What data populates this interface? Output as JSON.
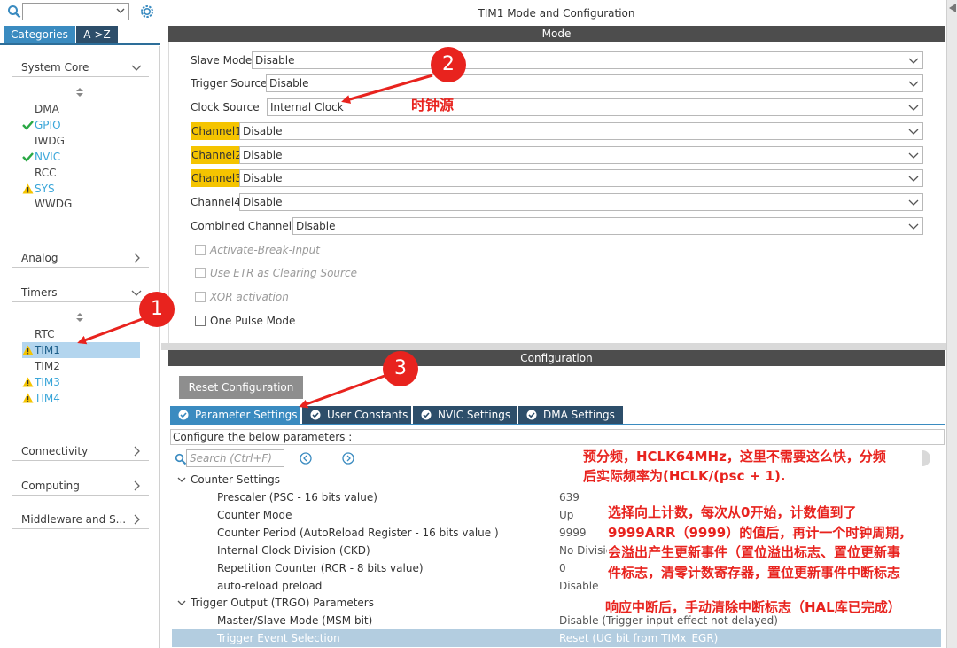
{
  "sidebar": {
    "tabs": {
      "categories": "Categories",
      "az": "A->Z"
    },
    "categories": {
      "system_core": "System Core",
      "analog": "Analog",
      "timers": "Timers",
      "connectivity": "Connectivity",
      "computing": "Computing",
      "middleware": "Middleware and S..."
    },
    "system_core_items": [
      {
        "label": "DMA",
        "status": "none"
      },
      {
        "label": "GPIO",
        "status": "ok"
      },
      {
        "label": "IWDG",
        "status": "none"
      },
      {
        "label": "NVIC",
        "status": "ok"
      },
      {
        "label": "RCC",
        "status": "none"
      },
      {
        "label": "SYS",
        "status": "warn"
      },
      {
        "label": "WWDG",
        "status": "none"
      }
    ],
    "timer_items": [
      {
        "label": "RTC",
        "status": "none"
      },
      {
        "label": "TIM1",
        "status": "warn",
        "selected": true
      },
      {
        "label": "TIM2",
        "status": "none"
      },
      {
        "label": "TIM3",
        "status": "warn"
      },
      {
        "label": "TIM4",
        "status": "warn"
      }
    ]
  },
  "window_title": "TIM1 Mode and Configuration",
  "mode": {
    "header": "Mode",
    "slave_mode": {
      "label": "Slave Mode",
      "value": "Disable"
    },
    "trigger_source": {
      "label": "Trigger Source",
      "value": "Disable"
    },
    "clock_source": {
      "label": "Clock Source",
      "value": "Internal Clock"
    },
    "channel1": {
      "label": "Channel1",
      "value": "Disable"
    },
    "channel2": {
      "label": "Channel2",
      "value": "Disable"
    },
    "channel3": {
      "label": "Channel3",
      "value": "Disable"
    },
    "channel4": {
      "label": "Channel4",
      "value": "Disable"
    },
    "combined_channels": {
      "label": "Combined Channels",
      "value": "Disable"
    },
    "checkboxes": {
      "activate_break": "Activate-Break-Input",
      "use_etr": "Use ETR as Clearing Source",
      "xor": "XOR activation",
      "one_pulse": "One Pulse Mode"
    }
  },
  "configuration": {
    "header": "Configuration",
    "reset_button": "Reset Configuration",
    "tabs": {
      "parameter": "Parameter Settings",
      "user_constants": "User Constants",
      "nvic": "NVIC Settings",
      "dma": "DMA Settings"
    },
    "hint": "Configure the below parameters :",
    "search_placeholder": "Search (Ctrl+F)",
    "groups": {
      "counter": "Counter Settings",
      "trgo": "Trigger Output (TRGO) Parameters"
    },
    "params": {
      "prescaler": {
        "name": "Prescaler (PSC - 16 bits value)",
        "value": "639"
      },
      "counter_mode": {
        "name": "Counter Mode",
        "value": "Up"
      },
      "counter_period": {
        "name": "Counter Period (AutoReload Register - 16 bits value )",
        "value": "9999"
      },
      "ckd": {
        "name": "Internal Clock Division (CKD)",
        "value": "No Divisio"
      },
      "rcr": {
        "name": "Repetition Counter (RCR - 8 bits value)",
        "value": "0"
      },
      "arpe": {
        "name": "auto-reload preload",
        "value": "Disable"
      },
      "msm": {
        "name": "Master/Slave Mode (MSM bit)",
        "value": "Disable (Trigger input effect not delayed)"
      },
      "trgo_sel": {
        "name": "Trigger Event Selection",
        "value": "Reset (UG bit from TIMx_EGR)"
      }
    }
  },
  "annotations": {
    "badge1": "1",
    "badge2": "2",
    "badge3": "3",
    "clock_note": "时钟源",
    "prescaler_note_1": "预分频，HCLK64MHz，这里不需要这么快，分频",
    "prescaler_note_2": "后实际频率为(HCLK/(psc + 1).",
    "counter_note_1": "选择向上计数，每次从0开始，计数值到了",
    "counter_note_2": "9999ARR（9999）的值后，再计一个时钟周期，",
    "counter_note_3": "会溢出产生更新事件（置位溢出标志、置位更新事",
    "counter_note_4": "件标志，清零计数寄存器，置位更新事件中断标志",
    "interrupt_note": "响应中断后，手动清除中断标志（HAL库已完成）"
  },
  "colors": {
    "accent_blue": "#3a8bc0",
    "dark_tab": "#2d4e6a",
    "header_bar": "#4d4d4d",
    "channel_highlight": "#f5c400",
    "annotation_red": "#e8231e",
    "ok_green": "#2aa845",
    "warn_yellow": "#f5c400"
  }
}
